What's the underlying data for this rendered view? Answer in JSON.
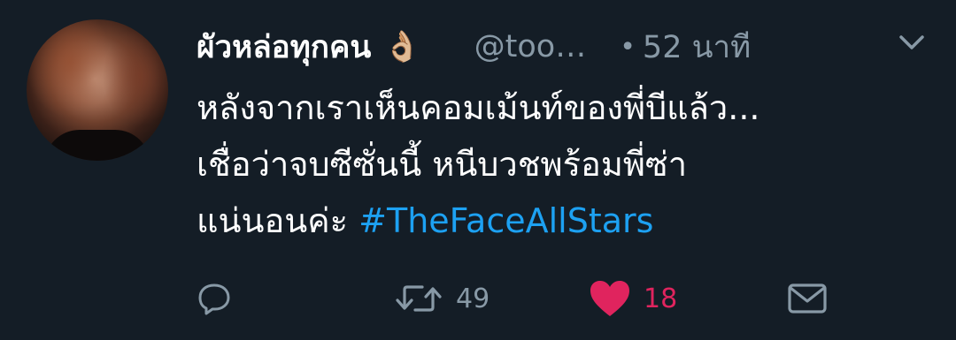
{
  "tweet": {
    "display_name": "ผัวหล่อทุกคน",
    "emoji": "👌🏼",
    "handle": "@too…",
    "separator": "•",
    "time": "52 นาที",
    "body_lines": [
      "หลังจากเราเห็นคอมเม้นท์ของพี่บีแล้ว...",
      "เชื่อว่าจบซีซั่นนี้ หนีบวชพร้อมพี่ซ่า",
      "แน่นอนค่ะ "
    ],
    "hashtag": "#TheFaceAllStars"
  },
  "actions": {
    "retweet_count": "49",
    "like_count": "18"
  },
  "colors": {
    "background": "#141d26",
    "secondary_text": "#8899a6",
    "link": "#1da1f2",
    "like": "#e0245e"
  },
  "icons": {
    "reply": "reply-icon",
    "retweet": "retweet-icon",
    "like": "heart-icon",
    "dm": "direct-message-icon",
    "caret": "chevron-down-icon"
  }
}
